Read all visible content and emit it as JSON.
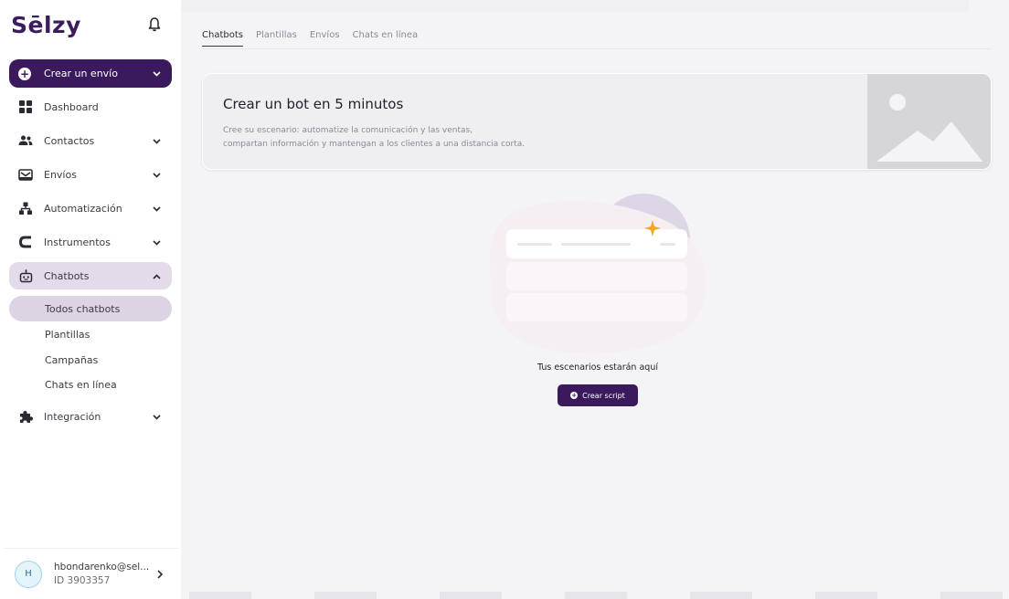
{
  "sidebar": {
    "logo": "Sēlzy",
    "create_label": "Crear un envío",
    "items": [
      {
        "label": "Dashboard"
      },
      {
        "label": "Contactos"
      },
      {
        "label": "Envíos"
      },
      {
        "label": "Automatización"
      },
      {
        "label": "Instrumentos"
      },
      {
        "label": "Chatbots"
      }
    ],
    "subitems": [
      {
        "label": "Todos chatbots"
      },
      {
        "label": "Plantillas"
      },
      {
        "label": "Campañas"
      },
      {
        "label": "Chats en línea"
      }
    ],
    "integration_label": "Integración",
    "user": {
      "initial": "H",
      "email": "hbondarenko@sel...",
      "id": "ID 3903357"
    }
  },
  "main": {
    "tabs": [
      {
        "label": "Chatbots"
      },
      {
        "label": "Plantillas"
      },
      {
        "label": "Envíos"
      },
      {
        "label": "Chats en línea"
      }
    ],
    "banner": {
      "title": "Crear un bot en 5 minutos",
      "desc_line1": "Cree su escenario: automatize la comunicación y las ventas,",
      "desc_line2": "compartan información y mantengan a los clientes a una distancia corta."
    },
    "empty_text": "Tus escenarios estarán aquí",
    "create_script_label": "Crear script"
  },
  "colors": {
    "accent": "#3a1a5c",
    "active_bg": "#e3dbe9",
    "star": "#f5a623"
  }
}
